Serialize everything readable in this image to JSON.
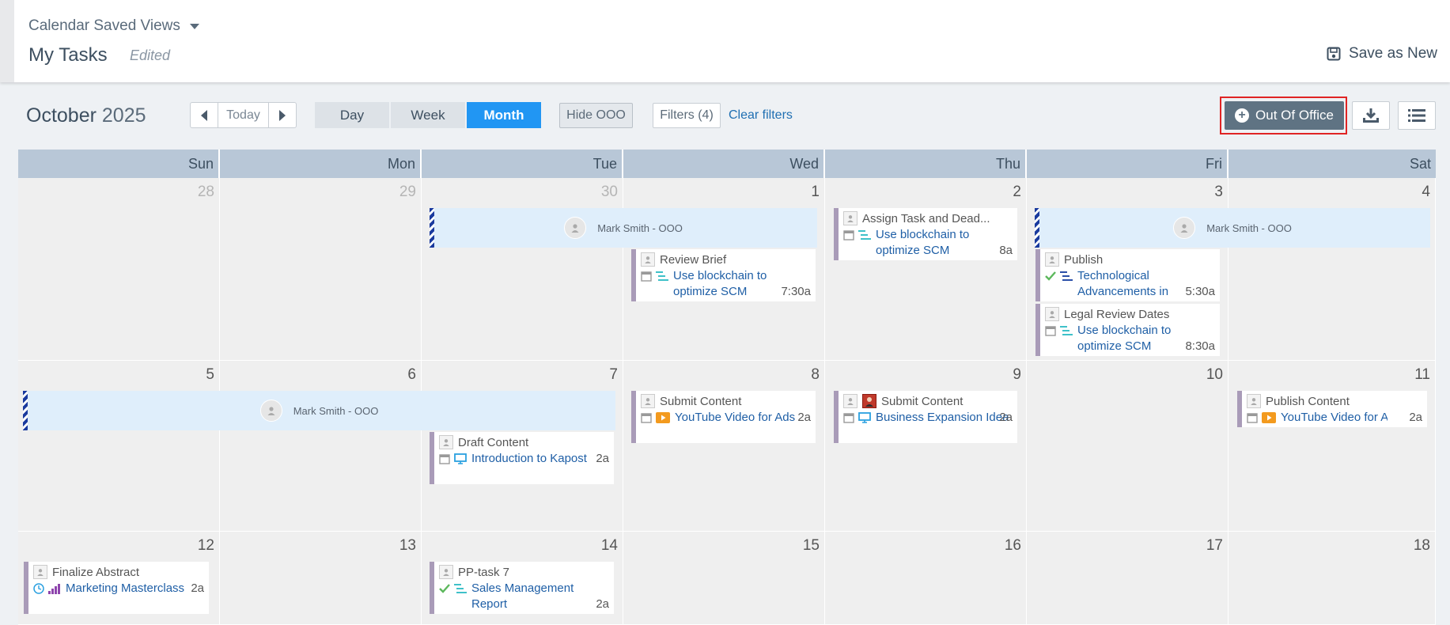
{
  "header": {
    "saved_views_label": "Calendar Saved Views",
    "page_title": "My Tasks",
    "status": "Edited",
    "save_as_new_label": "Save as New"
  },
  "toolbar": {
    "month": "October",
    "year": "2025",
    "today_label": "Today",
    "views": [
      {
        "label": "Day",
        "active": false
      },
      {
        "label": "Week",
        "active": false
      },
      {
        "label": "Month",
        "active": true
      }
    ],
    "hide_ooo_label": "Hide OOO",
    "filters_label": "Filters (4)",
    "clear_filters_label": "Clear filters",
    "out_of_office_label": "Out Of Office",
    "accent_color": "#2196f3",
    "ooo_button_color": "#5f7383"
  },
  "weekdays": [
    "Sun",
    "Mon",
    "Tue",
    "Wed",
    "Thu",
    "Fri",
    "Sat"
  ],
  "weeks": [
    [
      "28",
      "29",
      "30",
      "1",
      "2",
      "3",
      "4"
    ],
    [
      "5",
      "6",
      "7",
      "8",
      "9",
      "10",
      "11"
    ],
    [
      "12",
      "13",
      "14",
      "15",
      "16",
      "17",
      "18"
    ]
  ],
  "ooo_label": "Mark Smith - OOO",
  "events": {
    "assign_task": {
      "stage": "Assign Task and Dead...",
      "title": "Use blockchain to optimize SCM",
      "time": "8a"
    },
    "review_brief": {
      "stage": "Review Brief",
      "title": "Use blockchain to optimize SCM",
      "time": "7:30a"
    },
    "publish": {
      "stage": "Publish",
      "title": "Technological Advancements in",
      "time": "5:30a"
    },
    "legal_review": {
      "stage": "Legal Review Dates",
      "title": "Use blockchain to optimize SCM",
      "time": "8:30a"
    },
    "draft_content": {
      "stage": "Draft Content",
      "title": "Introduction to Kapost",
      "time": "2a"
    },
    "submit_content_1": {
      "stage": "Submit Content",
      "title": "YouTube Video for Ads",
      "time": "2a"
    },
    "submit_content_2": {
      "stage": "Submit Content",
      "title": "Business Expansion Idea",
      "time": "2a"
    },
    "publish_content": {
      "stage": "Publish Content",
      "title": "YouTube Video for Ac",
      "time": "2a"
    },
    "finalize_abstract": {
      "stage": "Finalize Abstract",
      "title": "Marketing Masterclass",
      "time": "2a"
    },
    "pp_task": {
      "stage": "PP-task 7",
      "title": "Sales Management Report",
      "time": "2a"
    }
  }
}
